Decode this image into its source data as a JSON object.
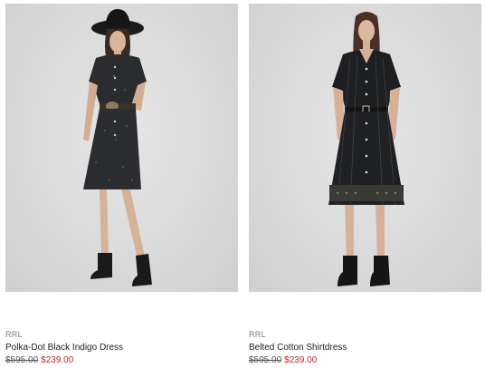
{
  "colors": {
    "background": "#ffffff",
    "image_bg": "#dcdcdc",
    "sale_price": "#c4262e",
    "original_price": "#555555",
    "brand_text": "#7a7a7a",
    "title_text": "#222222"
  },
  "products": [
    {
      "brand": "RRL",
      "name": "Polka-Dot Black Indigo Dress",
      "original_price": "$595.00",
      "sale_price": "$239.00",
      "image": "model-in-hat-wearing-polka-dot-dress"
    },
    {
      "brand": "RRL",
      "name": "Belted Cotton Shirtdress",
      "original_price": "$595.00",
      "sale_price": "$239.00",
      "image": "model-wearing-belted-shirtdress"
    }
  ]
}
